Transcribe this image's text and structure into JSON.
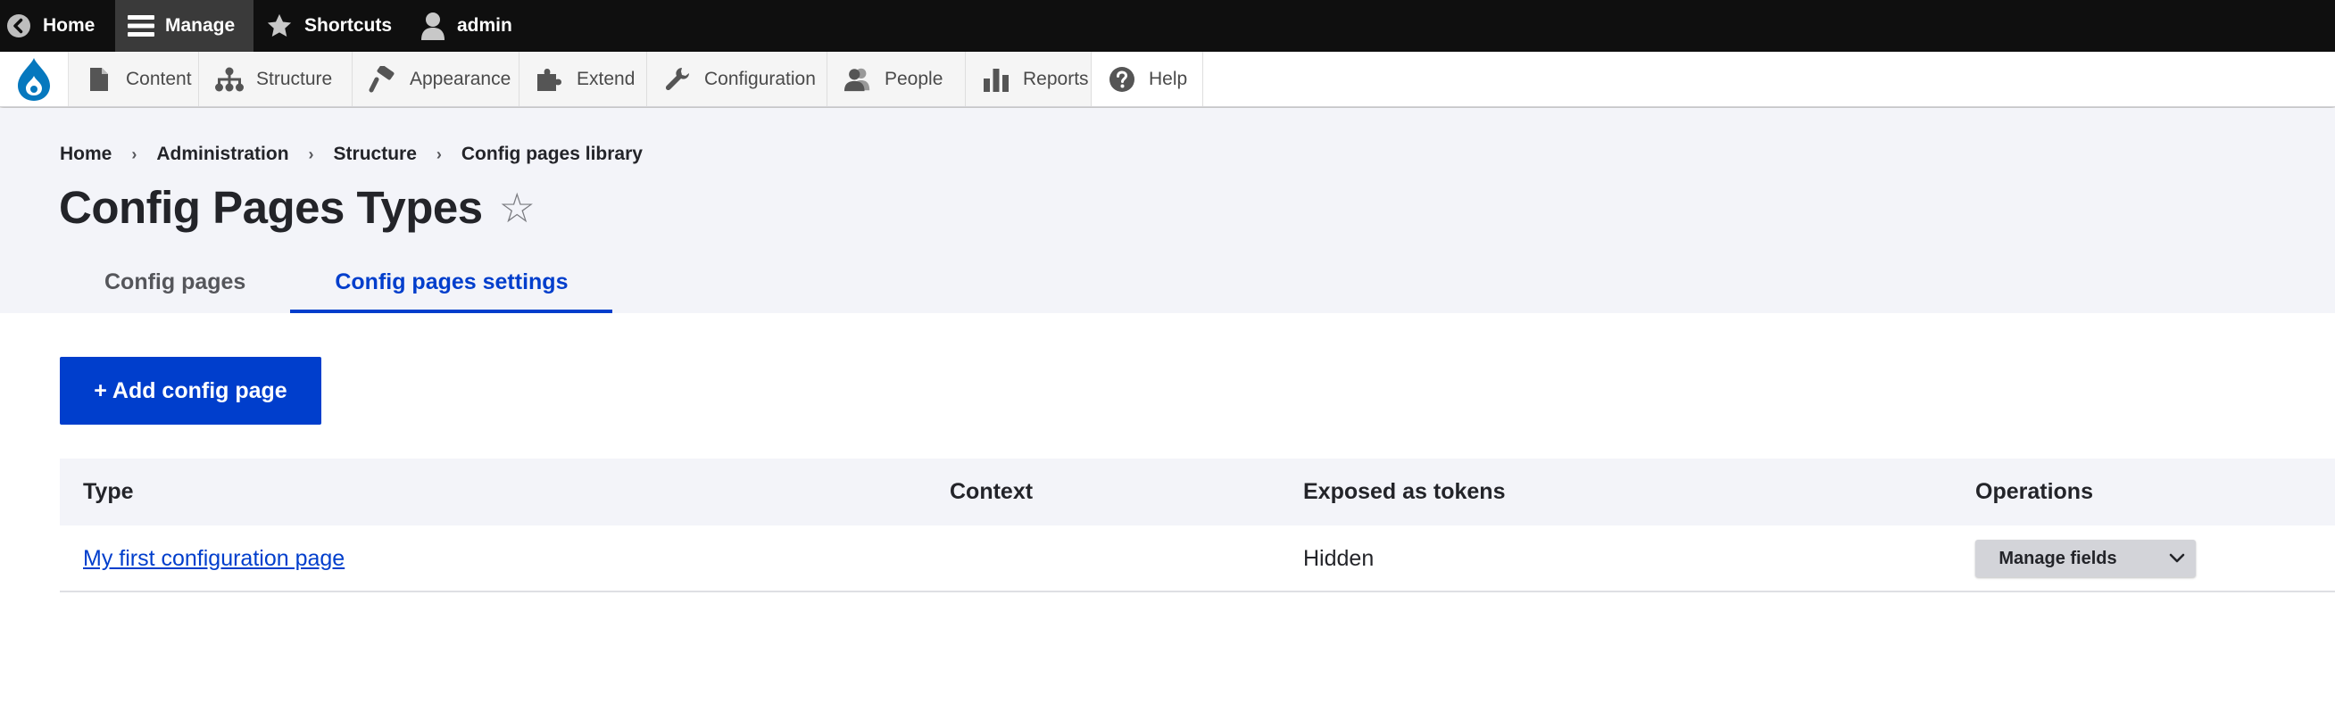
{
  "toolbar": {
    "home": "Home",
    "manage": "Manage",
    "shortcuts": "Shortcuts",
    "user": "admin"
  },
  "menu": {
    "items": [
      {
        "label": "Content",
        "icon": "document-icon"
      },
      {
        "label": "Structure",
        "icon": "sitemap-icon"
      },
      {
        "label": "Appearance",
        "icon": "paint-roller-icon"
      },
      {
        "label": "Extend",
        "icon": "puzzle-icon"
      },
      {
        "label": "Configuration",
        "icon": "wrench-icon"
      },
      {
        "label": "People",
        "icon": "people-icon"
      },
      {
        "label": "Reports",
        "icon": "bar-chart-icon"
      },
      {
        "label": "Help",
        "icon": "question-icon"
      }
    ]
  },
  "breadcrumb": [
    "Home",
    "Administration",
    "Structure",
    "Config pages library"
  ],
  "page": {
    "title": "Config Pages Types",
    "star": "☆"
  },
  "tabs": [
    {
      "label": "Config pages",
      "active": false
    },
    {
      "label": "Config pages settings",
      "active": true
    }
  ],
  "actions": {
    "add": "+ Add config page"
  },
  "table": {
    "headers": [
      "Type",
      "Context",
      "Exposed as tokens",
      "Operations"
    ],
    "rows": [
      {
        "type": "My first configuration page",
        "context": "",
        "exposed": "Hidden",
        "operation": "Manage fields"
      }
    ]
  },
  "colors": {
    "accent": "#003ecc",
    "toolbar_bg": "#0f0f0f",
    "header_bg": "#f3f4f9",
    "drupal_blue": "#0678be"
  }
}
